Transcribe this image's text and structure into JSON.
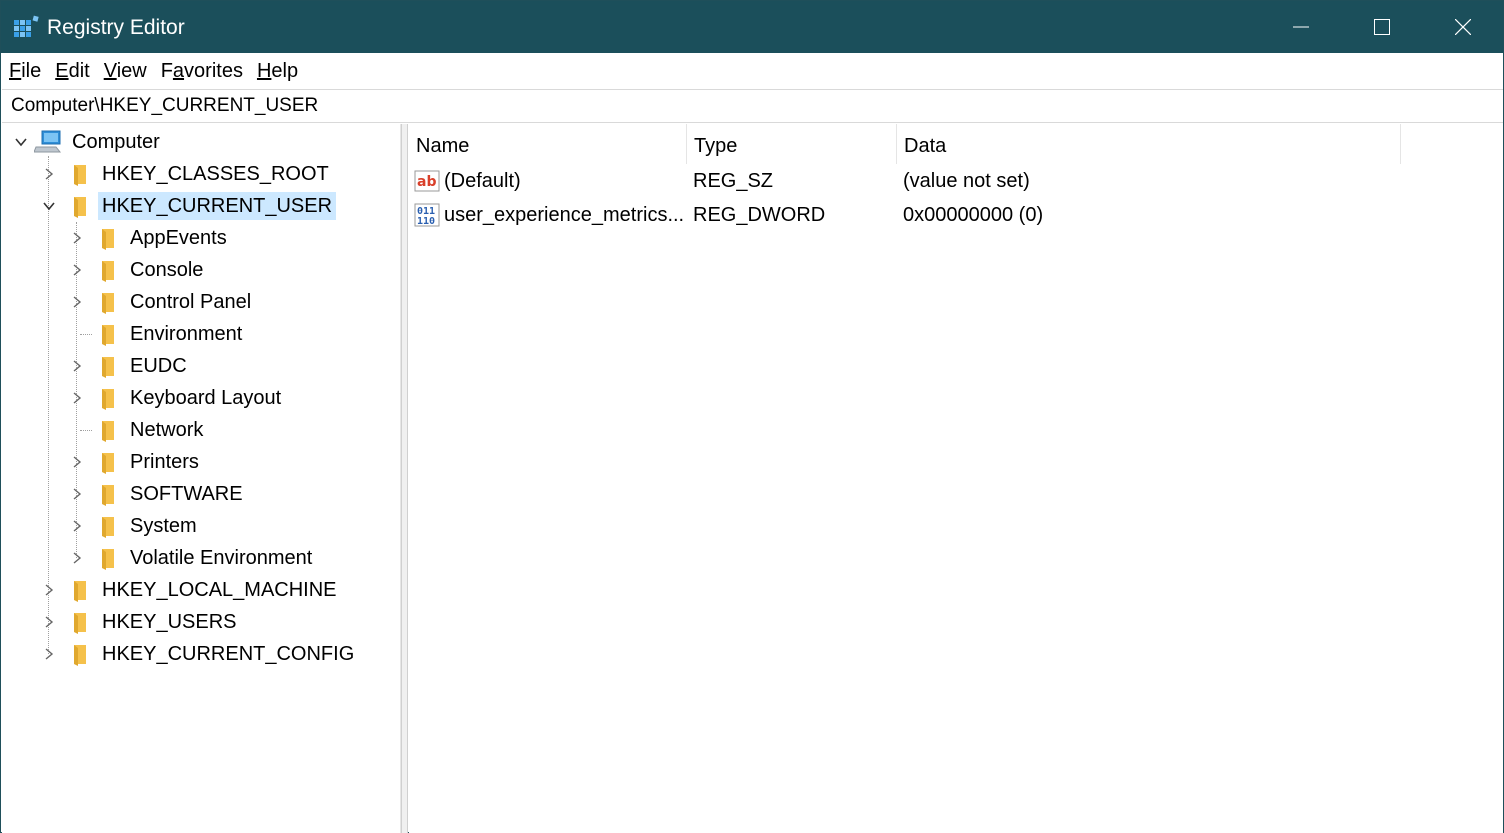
{
  "window": {
    "title": "Registry Editor",
    "colors": {
      "titlebar": "#1b4f5b",
      "selection": "#cce8ff",
      "folder": "#f5c14b"
    },
    "icons": {
      "app": "registry-editor-icon",
      "minimize": "minimize-icon",
      "maximize": "maximize-icon",
      "close": "close-icon"
    }
  },
  "menu": {
    "items": [
      {
        "accel": "F",
        "rest": "ile"
      },
      {
        "accel": "E",
        "rest": "dit"
      },
      {
        "accel": "V",
        "rest": "iew"
      },
      {
        "pre": "F",
        "accel": "a",
        "rest": "vorites"
      },
      {
        "accel": "H",
        "rest": "elp"
      }
    ]
  },
  "address": {
    "path": "Computer\\HKEY_CURRENT_USER"
  },
  "tree": {
    "root": "Computer",
    "hives": [
      "HKEY_CLASSES_ROOT",
      "HKEY_CURRENT_USER",
      "HKEY_LOCAL_MACHINE",
      "HKEY_USERS",
      "HKEY_CURRENT_CONFIG"
    ],
    "selected": "HKEY_CURRENT_USER",
    "children": [
      "AppEvents",
      "Console",
      "Control Panel",
      "Environment",
      "EUDC",
      "Keyboard Layout",
      "Network",
      "Printers",
      "SOFTWARE",
      "System",
      "Volatile Environment"
    ]
  },
  "list": {
    "columns": [
      "Name",
      "Type",
      "Data"
    ],
    "rows": [
      {
        "icon": "string-value-icon",
        "name": "(Default)",
        "type": "REG_SZ",
        "data": "(value not set)"
      },
      {
        "icon": "binary-value-icon",
        "name": "user_experience_metrics...",
        "type": "REG_DWORD",
        "data": "0x00000000 (0)"
      }
    ]
  }
}
